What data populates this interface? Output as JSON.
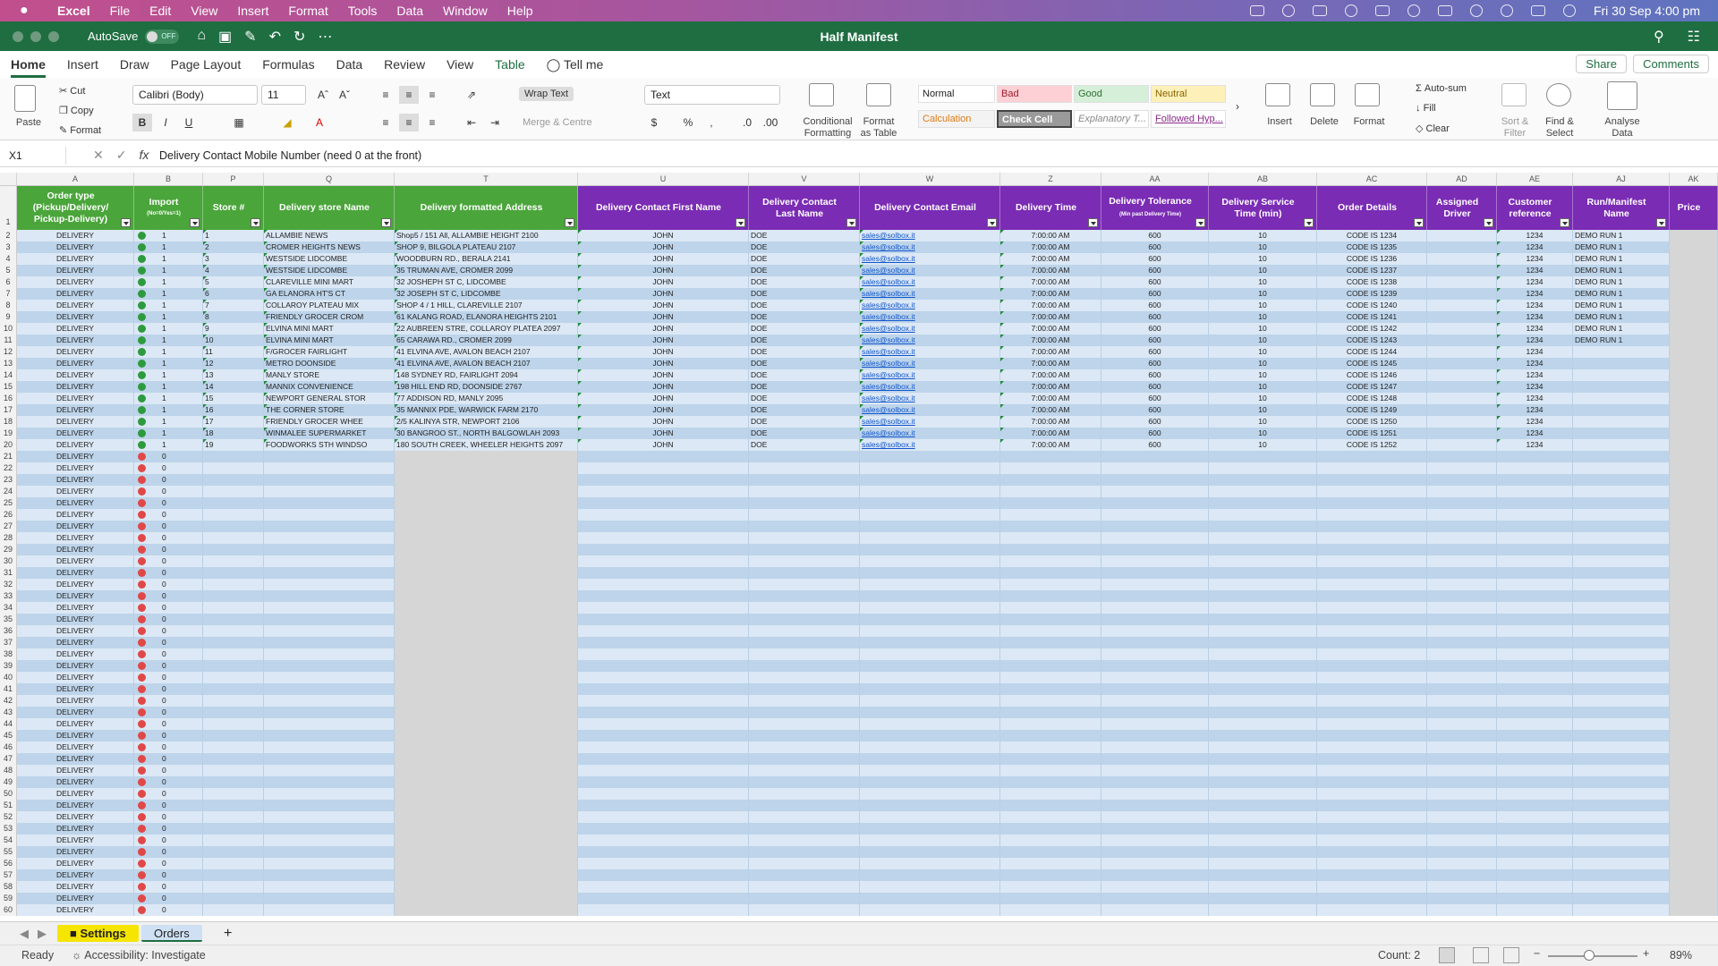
{
  "macmenu": {
    "app": "Excel",
    "items": [
      "File",
      "Edit",
      "View",
      "Insert",
      "Format",
      "Tools",
      "Data",
      "Window",
      "Help"
    ],
    "clock": "Fri 30 Sep  4:00 pm"
  },
  "titlebar": {
    "autosave": "AutoSave",
    "toggle": "OFF",
    "title": "Half Manifest"
  },
  "ribbon_tabs": [
    "Home",
    "Insert",
    "Draw",
    "Page Layout",
    "Formulas",
    "Data",
    "Review",
    "View",
    "Table",
    "Tell me"
  ],
  "share": "Share",
  "comments": "Comments",
  "ribbon": {
    "paste": "Paste",
    "cut": "Cut",
    "copy": "Copy",
    "format": "Format",
    "font": "Calibri (Body)",
    "size": "11",
    "wrap_text": "Wrap Text",
    "merge": "Merge & Centre",
    "number_format": "Text",
    "cond_format": "Conditional Formatting",
    "format_table": "Format as Table",
    "styles": {
      "normal": "Normal",
      "bad": "Bad",
      "good": "Good",
      "neutral": "Neutral",
      "calculation": "Calculation",
      "check": "Check Cell",
      "explanatory": "Explanatory T...",
      "followed": "Followed Hyp..."
    },
    "insert": "Insert",
    "delete": "Delete",
    "format_cells": "Format",
    "autosum": "Auto-sum",
    "fill": "Fill",
    "clear": "Clear",
    "sort": "Sort & Filter",
    "find": "Find & Select",
    "analyse": "Analyse Data"
  },
  "formula_bar": {
    "name_box": "X1",
    "fx": "fx",
    "formula": "Delivery Contact Mobile Number (need 0 at the front)"
  },
  "columns": [
    "A",
    "B",
    "P",
    "Q",
    "T",
    "U",
    "V",
    "W",
    "Z",
    "AA",
    "AB",
    "AC",
    "AD",
    "AE",
    "AJ",
    "AK"
  ],
  "headers": [
    "Order type (Pickup/Delivery/ Pickup-Delivery)",
    "Import",
    "Store #",
    "Delivery store Name",
    "Delivery formatted Address",
    "Delivery Contact First Name",
    "Delivery Contact Last Name",
    "Delivery Contact Email",
    "Delivery Time",
    "Delivery Tolerance",
    "Delivery Service Time (min)",
    "Order Details",
    "Assigned Driver",
    "Customer reference",
    "Run/Manifest Name",
    "Price"
  ],
  "header_subs": {
    "import": "(No=0/Yes=1)",
    "tolerance": "(Min past Delivery Time)"
  },
  "data_rows": [
    {
      "store": "1",
      "name": "ALLAMBIE NEWS",
      "addr": "Shop5 / 151 All, ALLAMBIE HEIGHT 2100",
      "code": "CODE IS 1234",
      "run": "DEMO RUN 1"
    },
    {
      "store": "2",
      "name": "CROMER HEIGHTS NEWS",
      "addr": "SHOP 9, BILGOLA PLATEAU 2107",
      "code": "CODE IS 1235",
      "run": "DEMO RUN 1"
    },
    {
      "store": "3",
      "name": "WESTSIDE LIDCOMBE",
      "addr": "WOODBURN RD., BERALA 2141",
      "code": "CODE IS 1236",
      "run": "DEMO RUN 1"
    },
    {
      "store": "4",
      "name": "WESTSIDE LIDCOMBE",
      "addr": "35 TRUMAN AVE, CROMER 2099",
      "code": "CODE IS 1237",
      "run": "DEMO RUN 1"
    },
    {
      "store": "5",
      "name": "CLAREVILLE MINI MART",
      "addr": "32 JOSHEPH ST C, LIDCOMBE",
      "code": "CODE IS 1238",
      "run": "DEMO RUN 1"
    },
    {
      "store": "6",
      "name": "GA ELANORA HT'S  CT",
      "addr": "32 JOSEPH ST C, LIDCOMBE",
      "code": "CODE IS 1239",
      "run": "DEMO RUN 1"
    },
    {
      "store": "7",
      "name": "COLLAROY PLATEAU MIX",
      "addr": "SHOP 4 / 1 HILL, CLAREVILLE 2107",
      "code": "CODE IS 1240",
      "run": "DEMO RUN 1"
    },
    {
      "store": "8",
      "name": "FRIENDLY GROCER CROM",
      "addr": "61 KALANG ROAD, ELANORA HEIGHTS 2101",
      "code": "CODE IS 1241",
      "run": "DEMO RUN 1"
    },
    {
      "store": "9",
      "name": "ELVINA MINI MART",
      "addr": "22 AUBREEN STRE, COLLAROY PLATEA 2097",
      "code": "CODE IS 1242",
      "run": "DEMO RUN 1"
    },
    {
      "store": "10",
      "name": "ELVINA MINI MART",
      "addr": "65 CARAWA RD., CROMER 2099",
      "code": "CODE IS 1243",
      "run": "DEMO RUN 1"
    },
    {
      "store": "11",
      "name": "F/GROCER  FAIRLIGHT",
      "addr": "41 ELVINA AVE, AVALON BEACH 2107",
      "code": "CODE IS 1244",
      "run": ""
    },
    {
      "store": "12",
      "name": "METRO DOONSIDE",
      "addr": "41 ELVINA AVE, AVALON BEACH 2107",
      "code": "CODE IS 1245",
      "run": ""
    },
    {
      "store": "13",
      "name": "MANLY STORE",
      "addr": "148 SYDNEY RD, FAIRLIGHT 2094",
      "code": "CODE IS 1246",
      "run": ""
    },
    {
      "store": "14",
      "name": "MANNIX CONVENIENCE",
      "addr": "198 HILL END RD, DOONSIDE 2767",
      "code": "CODE IS 1247",
      "run": ""
    },
    {
      "store": "15",
      "name": "NEWPORT GENERAL STOR",
      "addr": "77 ADDISON RD, MANLY 2095",
      "code": "CODE IS 1248",
      "run": ""
    },
    {
      "store": "16",
      "name": "THE CORNER STORE",
      "addr": "35 MANNIX PDE, WARWICK FARM 2170",
      "code": "CODE IS 1249",
      "run": ""
    },
    {
      "store": "17",
      "name": "FRIENDLY GROCER WHEE",
      "addr": "2/5 KALINYA STR, NEWPORT 2106",
      "code": "CODE IS 1250",
      "run": ""
    },
    {
      "store": "18",
      "name": "WINMALEE SUPERMARKET",
      "addr": "30 BANGROO ST., NORTH BALGOWLAH 2093",
      "code": "CODE IS 1251",
      "run": ""
    },
    {
      "store": "19",
      "name": "FOODWORKS STH WINDSO",
      "addr": "180 SOUTH CREEK, WHEELER HEIGHTS 2097",
      "code": "CODE IS 1252",
      "run": ""
    }
  ],
  "row_defaults": {
    "type": "DELIVERY",
    "import_yes": "1",
    "import_no": "0",
    "first": "JOHN",
    "last": "DOE",
    "email": "sales@solbox.it",
    "time": "7:00:00 AM",
    "tolerance": "600",
    "service": "10",
    "customer_ref": "1234"
  },
  "row_numbers": [
    "1",
    "2",
    "3",
    "4",
    "5",
    "6",
    "7",
    "8",
    "9",
    "10",
    "11",
    "12",
    "13",
    "14",
    "15",
    "16",
    "17",
    "18",
    "19",
    "20",
    "21",
    "22",
    "23",
    "24",
    "25",
    "26",
    "27",
    "28",
    "29",
    "30",
    "31",
    "32",
    "33",
    "34",
    "35",
    "36",
    "37",
    "38",
    "39",
    "40",
    "41",
    "42",
    "43",
    "44",
    "45",
    "46",
    "47",
    "48",
    "49",
    "50",
    "51",
    "52",
    "53",
    "54",
    "55",
    "56",
    "57",
    "58",
    "59",
    "60"
  ],
  "sheets": [
    "Settings",
    "Orders"
  ],
  "status": {
    "ready": "Ready",
    "accessibility": "Accessibility: Investigate",
    "count": "Count: 2",
    "zoom": "89%"
  }
}
